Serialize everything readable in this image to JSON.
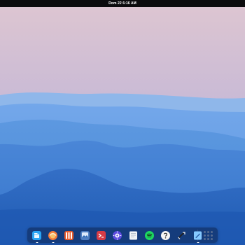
{
  "topbar": {
    "datetime": "Dom 22 6:16 AM"
  },
  "dock": {
    "apps": [
      {
        "name": "files-icon",
        "color": "#2aa4f4",
        "label": "—",
        "running": true
      },
      {
        "name": "browser-icon",
        "color": "#f57c3a",
        "label": "",
        "running": true
      },
      {
        "name": "app-center-icon",
        "color": "#e85d2f",
        "label": "",
        "running": false
      },
      {
        "name": "photos-icon",
        "color": "#4f7fc3",
        "label": "",
        "running": false
      },
      {
        "name": "terminal-icon",
        "color": "#d63b46",
        "label": "",
        "running": false
      },
      {
        "name": "settings-icon",
        "color": "#5e4de0",
        "label": "",
        "running": false
      },
      {
        "name": "notes-icon",
        "color": "#f2f4f6",
        "label": "",
        "running": false
      },
      {
        "name": "spotify-icon",
        "color": "#1ed760",
        "label": "",
        "running": false
      },
      {
        "name": "help-icon",
        "color": "#f5f5f5",
        "label": "",
        "running": false
      },
      {
        "name": "tool-icon",
        "color": "#222222",
        "label": "",
        "running": false
      },
      {
        "name": "editor-icon",
        "color": "#84c8ff",
        "label": "",
        "running": true
      }
    ],
    "launcher": "applications-grid-icon"
  },
  "colors": {
    "sky_top": "#d9c5d1",
    "sky_bottom": "#99b3df",
    "water_top": "#4f8fe0",
    "water_bottom": "#1c5ab3"
  }
}
